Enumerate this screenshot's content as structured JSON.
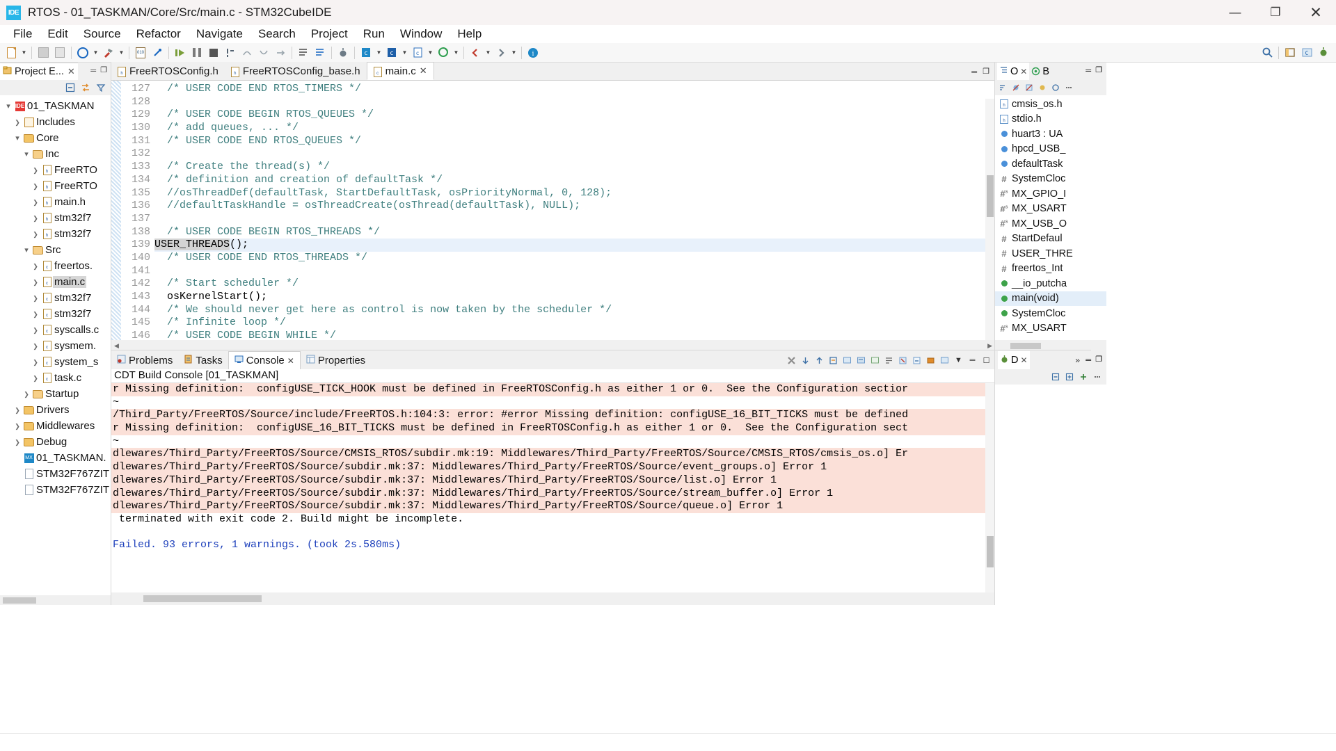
{
  "window": {
    "app_icon": "ide-logo-icon",
    "title": "RTOS - 01_TASKMAN/Core/Src/main.c - STM32CubeIDE",
    "minimize": "—",
    "maximize": "❐",
    "close": "✕"
  },
  "menubar": {
    "items": [
      {
        "label": "File"
      },
      {
        "label": "Edit"
      },
      {
        "label": "Source"
      },
      {
        "label": "Refactor"
      },
      {
        "label": "Navigate"
      },
      {
        "label": "Search"
      },
      {
        "label": "Project"
      },
      {
        "label": "Run"
      },
      {
        "label": "Window"
      },
      {
        "label": "Help"
      }
    ]
  },
  "project_explorer": {
    "tab_label": "Project E...",
    "tab_icon": "project-explorer-icon",
    "close_icon": "✕",
    "minimize_icon": "═",
    "maximize_icon": "❐",
    "toolbar_icons": [
      "collapse-all-icon",
      "link-with-editor-icon",
      "view-menu-filter-icon"
    ],
    "tree": [
      {
        "label": "01_TASKMAN",
        "depth": 0,
        "twisty": "open",
        "icon": "stm32-project-icon",
        "selected": false
      },
      {
        "label": "Includes",
        "depth": 1,
        "twisty": "closed",
        "icon": "includes-icon",
        "selected": false
      },
      {
        "label": "Core",
        "depth": 1,
        "twisty": "open",
        "icon": "source-folder-icon",
        "selected": false
      },
      {
        "label": "Inc",
        "depth": 2,
        "twisty": "open",
        "icon": "folder-icon",
        "selected": false
      },
      {
        "label": "FreeRTO",
        "depth": 3,
        "twisty": "closed",
        "icon": "header-file-icon",
        "selected": false
      },
      {
        "label": "FreeRTO",
        "depth": 3,
        "twisty": "closed",
        "icon": "header-file-icon",
        "selected": false
      },
      {
        "label": "main.h",
        "depth": 3,
        "twisty": "closed",
        "icon": "header-file-icon",
        "selected": false
      },
      {
        "label": "stm32f7",
        "depth": 3,
        "twisty": "closed",
        "icon": "header-file-icon",
        "selected": false
      },
      {
        "label": "stm32f7",
        "depth": 3,
        "twisty": "closed",
        "icon": "header-file-icon",
        "selected": false
      },
      {
        "label": "Src",
        "depth": 2,
        "twisty": "open",
        "icon": "folder-icon",
        "selected": false
      },
      {
        "label": "freertos.",
        "depth": 3,
        "twisty": "closed",
        "icon": "c-file-icon",
        "selected": false
      },
      {
        "label": "main.c",
        "depth": 3,
        "twisty": "closed",
        "icon": "c-file-icon",
        "selected": true
      },
      {
        "label": "stm32f7",
        "depth": 3,
        "twisty": "closed",
        "icon": "c-file-icon",
        "selected": false
      },
      {
        "label": "stm32f7",
        "depth": 3,
        "twisty": "closed",
        "icon": "c-file-icon",
        "selected": false
      },
      {
        "label": "syscalls.c",
        "depth": 3,
        "twisty": "closed",
        "icon": "c-file-icon",
        "selected": false
      },
      {
        "label": "sysmem.",
        "depth": 3,
        "twisty": "closed",
        "icon": "c-file-icon",
        "selected": false
      },
      {
        "label": "system_s",
        "depth": 3,
        "twisty": "closed",
        "icon": "c-file-icon",
        "selected": false
      },
      {
        "label": "task.c",
        "depth": 3,
        "twisty": "closed",
        "icon": "c-file-icon",
        "selected": false
      },
      {
        "label": "Startup",
        "depth": 2,
        "twisty": "closed",
        "icon": "folder-icon",
        "selected": false
      },
      {
        "label": "Drivers",
        "depth": 1,
        "twisty": "closed",
        "icon": "source-folder-icon",
        "selected": false
      },
      {
        "label": "Middlewares",
        "depth": 1,
        "twisty": "closed",
        "icon": "source-folder-icon",
        "selected": false
      },
      {
        "label": "Debug",
        "depth": 1,
        "twisty": "closed",
        "icon": "source-folder-icon",
        "selected": false
      },
      {
        "label": "01_TASKMAN.",
        "depth": 1,
        "twisty": "none",
        "icon": "ioc-file-icon",
        "selected": false
      },
      {
        "label": "STM32F767ZIT",
        "depth": 1,
        "twisty": "none",
        "icon": "ld-file-icon",
        "selected": false
      },
      {
        "label": "STM32F767ZIT",
        "depth": 1,
        "twisty": "none",
        "icon": "ld-file-icon",
        "selected": false
      }
    ]
  },
  "editor": {
    "tabs": [
      {
        "label": "FreeRTOSConfig.h",
        "icon": "header-file-icon",
        "active": false,
        "closable": false
      },
      {
        "label": "FreeRTOSConfig_base.h",
        "icon": "header-file-icon",
        "active": false,
        "closable": false
      },
      {
        "label": "main.c",
        "icon": "c-file-icon",
        "active": true,
        "closable": true,
        "close_icon": "✕"
      }
    ],
    "minimize_icon": "═",
    "maximize_icon": "❐",
    "first_line_number": 127,
    "lines": [
      {
        "n": 127,
        "text": "  /* USER CODE END RTOS_TIMERS */",
        "kind": "comment",
        "hl": false
      },
      {
        "n": 128,
        "text": "",
        "kind": "comment",
        "hl": false
      },
      {
        "n": 129,
        "text": "  /* USER CODE BEGIN RTOS_QUEUES */",
        "kind": "comment",
        "hl": false
      },
      {
        "n": 130,
        "text": "  /* add queues, ... */",
        "kind": "comment",
        "hl": false
      },
      {
        "n": 131,
        "text": "  /* USER CODE END RTOS_QUEUES */",
        "kind": "comment",
        "hl": false
      },
      {
        "n": 132,
        "text": "",
        "kind": "comment",
        "hl": false
      },
      {
        "n": 133,
        "text": "  /* Create the thread(s) */",
        "kind": "comment",
        "hl": false
      },
      {
        "n": 134,
        "text": "  /* definition and creation of defaultTask */",
        "kind": "comment",
        "hl": false
      },
      {
        "n": 135,
        "text": "  //osThreadDef(defaultTask, StartDefaultTask, osPriorityNormal, 0, 128);",
        "kind": "comment",
        "hl": false
      },
      {
        "n": 136,
        "text": "  //defaultTaskHandle = osThreadCreate(osThread(defaultTask), NULL);",
        "kind": "comment",
        "hl": false
      },
      {
        "n": 137,
        "text": "",
        "kind": "comment",
        "hl": false
      },
      {
        "n": 138,
        "text": "  /* USER CODE BEGIN RTOS_THREADS */",
        "kind": "comment",
        "hl": false
      },
      {
        "n": 139,
        "text": "USER_THREADS();",
        "kind": "code-token-highlight",
        "hl": true,
        "token": "USER_THREADS",
        "rest": "();"
      },
      {
        "n": 140,
        "text": "  /* USER CODE END RTOS_THREADS */",
        "kind": "comment",
        "hl": false
      },
      {
        "n": 141,
        "text": "",
        "kind": "comment",
        "hl": false
      },
      {
        "n": 142,
        "text": "  /* Start scheduler */",
        "kind": "comment",
        "hl": false
      },
      {
        "n": 143,
        "text": "  osKernelStart();",
        "kind": "code",
        "hl": false
      },
      {
        "n": 144,
        "text": "  /* We should never get here as control is now taken by the scheduler */",
        "kind": "comment",
        "hl": false
      },
      {
        "n": 145,
        "text": "  /* Infinite loop */",
        "kind": "comment",
        "hl": false
      },
      {
        "n": 146,
        "text": "  /* USER CODE BEGIN WHILE */",
        "kind": "comment",
        "hl": false
      }
    ]
  },
  "console": {
    "tabs": [
      {
        "label": "Problems",
        "icon": "problems-icon",
        "active": false
      },
      {
        "label": "Tasks",
        "icon": "tasks-icon",
        "active": false
      },
      {
        "label": "Console",
        "icon": "console-icon",
        "active": true,
        "close_icon": "✕"
      },
      {
        "label": "Properties",
        "icon": "properties-icon",
        "active": false
      }
    ],
    "toolbar_icons": [
      "terminate-icon",
      "scroll-down-icon",
      "scroll-up-icon",
      "pin-console-icon",
      "display-console-icon",
      "open-console-icon",
      "new-console-view-icon",
      "word-wrap-icon",
      "clear-console-icon",
      "scroll-lock-icon",
      "pin-icon",
      "display-selected-console-icon",
      "open-console-dropdown-icon",
      "minimize-icon",
      "maximize-icon"
    ],
    "title": "CDT Build Console [01_TASKMAN]",
    "lines": [
      {
        "text": "r Missing definition:  configUSE_TICK_HOOK must be defined in FreeRTOSConfig.h as either 1 or 0.  See the Configuration sectior",
        "style": "error"
      },
      {
        "text": "~",
        "style": "normal"
      },
      {
        "text": "/Third_Party/FreeRTOS/Source/include/FreeRTOS.h:104:3: error: #error Missing definition: configUSE_16_BIT_TICKS must be defined",
        "style": "error"
      },
      {
        "text": "r Missing definition:  configUSE_16_BIT_TICKS must be defined in FreeRTOSConfig.h as either 1 or 0.  See the Configuration sect",
        "style": "error"
      },
      {
        "text": "~",
        "style": "normal"
      },
      {
        "text": "dlewares/Third_Party/FreeRTOS/Source/CMSIS_RTOS/subdir.mk:19: Middlewares/Third_Party/FreeRTOS/Source/CMSIS_RTOS/cmsis_os.o] Er",
        "style": "error"
      },
      {
        "text": "dlewares/Third_Party/FreeRTOS/Source/subdir.mk:37: Middlewares/Third_Party/FreeRTOS/Source/event_groups.o] Error 1",
        "style": "error"
      },
      {
        "text": "dlewares/Third_Party/FreeRTOS/Source/subdir.mk:37: Middlewares/Third_Party/FreeRTOS/Source/list.o] Error 1",
        "style": "error"
      },
      {
        "text": "dlewares/Third_Party/FreeRTOS/Source/subdir.mk:37: Middlewares/Third_Party/FreeRTOS/Source/stream_buffer.o] Error 1",
        "style": "error"
      },
      {
        "text": "dlewares/Third_Party/FreeRTOS/Source/subdir.mk:37: Middlewares/Third_Party/FreeRTOS/Source/queue.o] Error 1",
        "style": "error"
      },
      {
        "text": " terminated with exit code 2. Build might be incomplete.",
        "style": "normal"
      },
      {
        "text": "",
        "style": "normal"
      },
      {
        "text": "Failed. 93 errors, 1 warnings. (took 2s.580ms)",
        "style": "fail"
      }
    ]
  },
  "outline": {
    "tab_label": "O",
    "tab_icon": "outline-icon",
    "tab2_label": "B",
    "tab2_icon": "build-targets-icon",
    "close_icon": "✕",
    "minimize_icon": "═",
    "maximize_icon": "❐",
    "toolbar_icons": [
      "sort-icon",
      "hide-fields-icon",
      "hide-static-icon",
      "hide-nonpublic-icon",
      "focus-icon",
      "menu-icon"
    ],
    "items": [
      {
        "label": "cmsis_os.h",
        "icon": "header-include-icon",
        "selected": false
      },
      {
        "label": "stdio.h",
        "icon": "header-include-icon",
        "selected": false
      },
      {
        "label": "huart3 : UA",
        "icon": "variable-icon",
        "selected": false
      },
      {
        "label": "hpcd_USB_",
        "icon": "variable-icon",
        "selected": false
      },
      {
        "label": "defaultTask",
        "icon": "variable-icon",
        "selected": false
      },
      {
        "label": "SystemCloc",
        "icon": "function-icon",
        "selected": false
      },
      {
        "label": "MX_GPIO_I",
        "icon": "static-function-icon",
        "selected": false
      },
      {
        "label": "MX_USART",
        "icon": "static-function-icon",
        "selected": false
      },
      {
        "label": "MX_USB_O",
        "icon": "static-function-icon",
        "selected": false
      },
      {
        "label": "StartDefaul",
        "icon": "function-icon",
        "selected": false
      },
      {
        "label": "USER_THRE",
        "icon": "function-icon",
        "selected": false
      },
      {
        "label": "freertos_Int",
        "icon": "function-icon",
        "selected": false
      },
      {
        "label": "__io_putcha",
        "icon": "function-def-icon",
        "selected": false
      },
      {
        "label": "main(void)",
        "icon": "function-def-icon",
        "selected": true
      },
      {
        "label": "SystemCloc",
        "icon": "function-def-icon",
        "selected": false
      },
      {
        "label": "MX_USART",
        "icon": "static-function-icon",
        "selected": false
      }
    ]
  },
  "debug_panel": {
    "tab_label": "D",
    "tab_icon": "debug-icon",
    "close_icon": "✕",
    "more_icon": "»",
    "minimize_icon": "═",
    "maximize_icon": "❐",
    "toolbar_icons": [
      "collapse-all-icon",
      "expand-icon",
      "add-icon",
      "menu-icon"
    ]
  },
  "toolbar": {
    "groups": [
      [
        "new-file-icon",
        "dropdown-arrow"
      ],
      [
        "save-icon",
        "save-all-icon"
      ],
      [
        "build-all-icon",
        "dropdown-arrow",
        "build-hammer-icon",
        "dropdown-arrow"
      ],
      [
        "binary-icon",
        "link-icon"
      ],
      [
        "resume-icon",
        "suspend-icon",
        "terminate-icon",
        "step-into-icon",
        "step-over-icon",
        "step-return-icon",
        "drop-to-frame-icon"
      ],
      [
        "open-declaration-icon",
        "search-declaration-icon"
      ],
      [
        "debug-config-icon"
      ],
      [
        "new-c-project-icon",
        "dropdown-arrow",
        "new-cpp-project-icon",
        "dropdown-arrow",
        "new-c-file-icon",
        "dropdown-arrow",
        "new-class-icon",
        "dropdown-arrow"
      ],
      [
        "back-icon",
        "dropdown-arrow",
        "forward-icon",
        "dropdown-arrow"
      ],
      [
        "info-icon"
      ]
    ],
    "right_icons": [
      "search-icon",
      "open-perspective-icon",
      "c-cpp-perspective-icon",
      "debug-perspective-icon"
    ]
  },
  "colors": {
    "accent_blue": "#29b6e8",
    "error_bg": "#fbe0d8",
    "fail_text": "#1c3fbb",
    "comment_green": "#3f7f7f",
    "selection_blue": "#e8f1fb",
    "titlebar_bg": "#f7f3f3"
  }
}
